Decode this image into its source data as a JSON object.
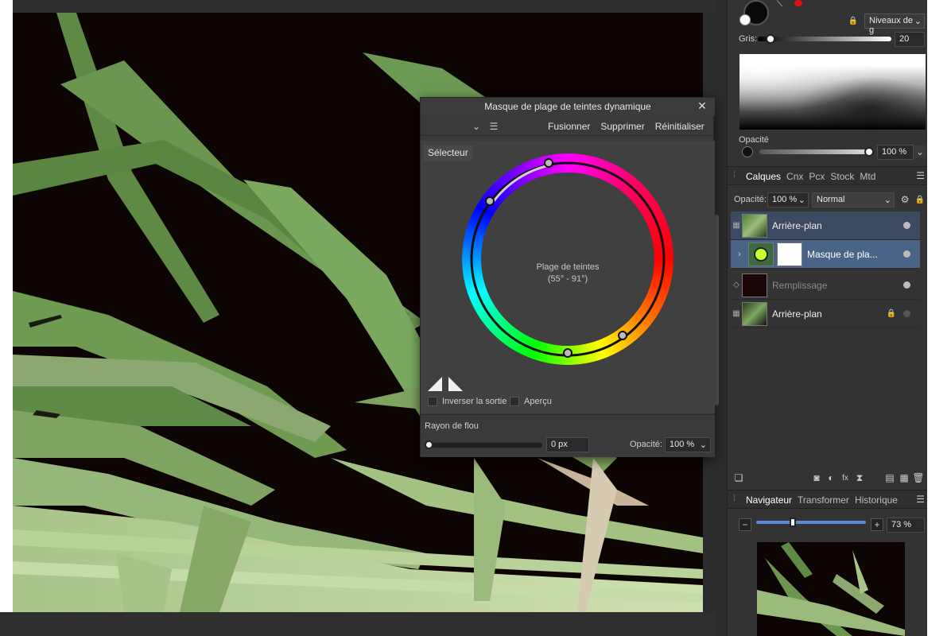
{
  "dialog": {
    "title": "Masque de plage de teintes dynamique",
    "close": "✕",
    "toolbar": {
      "merge": "Fusionner",
      "delete": "Supprimer",
      "reset": "Réinitialiser"
    },
    "selector_tab": "Sélecteur",
    "wheel_label": "Plage de teintes",
    "wheel_range": "(55° - 91°)",
    "invert_label": "Inverser la sortie",
    "preview_label": "Aperçu",
    "blur_label": "Rayon de flou",
    "blur_value": "0 px",
    "opacity_label": "Opacité:",
    "opacity_value": "100 %"
  },
  "color_panel": {
    "levels_select": "Niveaux de g",
    "gray_label": "Gris:",
    "gray_value": "20",
    "opacity_label": "Opacité",
    "opacity_value": "100 %"
  },
  "layers_panel": {
    "tabs": [
      "Calques",
      "Cnx",
      "Pcx",
      "Stock",
      "Mtd"
    ],
    "opacity_label": "Opacité:",
    "opacity_value": "100 %",
    "blend_mode": "Normal",
    "layers": [
      {
        "name": "Arrière-plan"
      },
      {
        "name": "Masque de pla..."
      },
      {
        "name": "Remplissage"
      },
      {
        "name": "Arrière-plan"
      }
    ]
  },
  "navigator_panel": {
    "tabs": [
      "Navigateur",
      "Transformer",
      "Historique"
    ],
    "zoom_value": "73 %"
  },
  "colors": {
    "panel_bg": "#333333",
    "selected_layer": "#3b4a60",
    "child_selected": "#4a6488",
    "canvas_bg": "#0d0404"
  }
}
